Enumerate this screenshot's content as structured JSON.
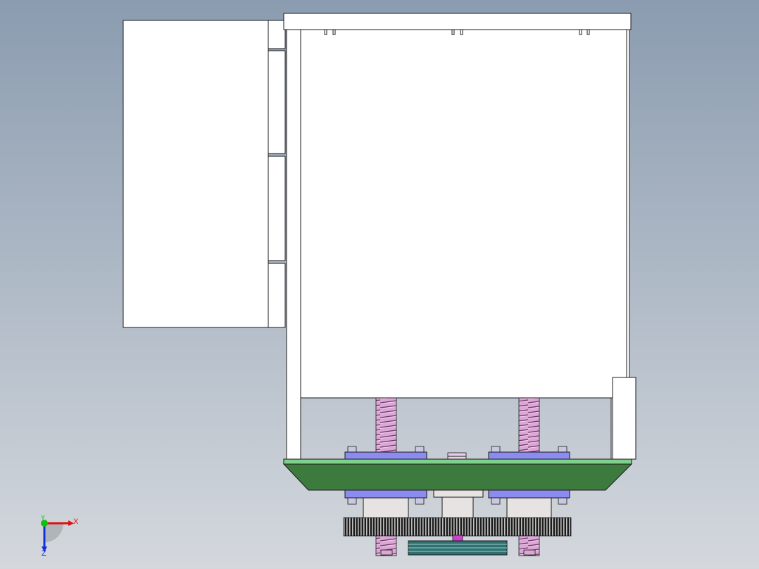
{
  "viewport": {
    "background_top": "#8b9cb0",
    "background_bottom": "#d4d8dd"
  },
  "colors": {
    "panel_fill": "#ffffff",
    "outline": "#1a1a1a",
    "base_plate_top": "#7ed08c",
    "base_plate_front": "#3d7a3d",
    "clamp_block": "#8c8cf0",
    "lead_screw": "#dca6d6",
    "hub": "#e8e3e3",
    "gear": "#2a2a2a",
    "bolt": "#c8c8e0",
    "pulley": "#2f7070",
    "axis_x": "#e01010",
    "axis_y": "#10c010",
    "axis_z": "#1030e0"
  },
  "triad": {
    "x_label": "X",
    "y_label": "Y",
    "z_label": "Z",
    "icon": "coordinate-triad-icon"
  }
}
